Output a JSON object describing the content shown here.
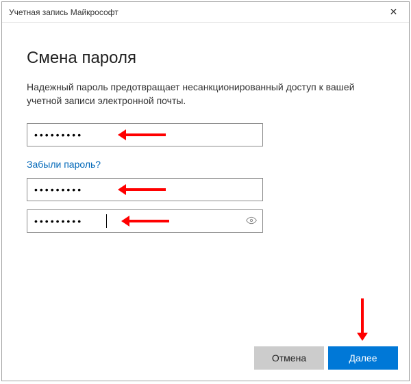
{
  "titlebar": {
    "title": "Учетная запись Майкрософт"
  },
  "content": {
    "heading": "Смена пароля",
    "description": "Надежный пароль предотвращает несанкционированный доступ к вашей учетной записи электронной почты.",
    "forgot_link": "Забыли пароль?"
  },
  "fields": {
    "current_password": {
      "value": "•••••••••"
    },
    "new_password": {
      "value": "•••••••••"
    },
    "confirm_password": {
      "value": "•••••••••"
    }
  },
  "buttons": {
    "cancel": "Отмена",
    "next": "Далее"
  }
}
